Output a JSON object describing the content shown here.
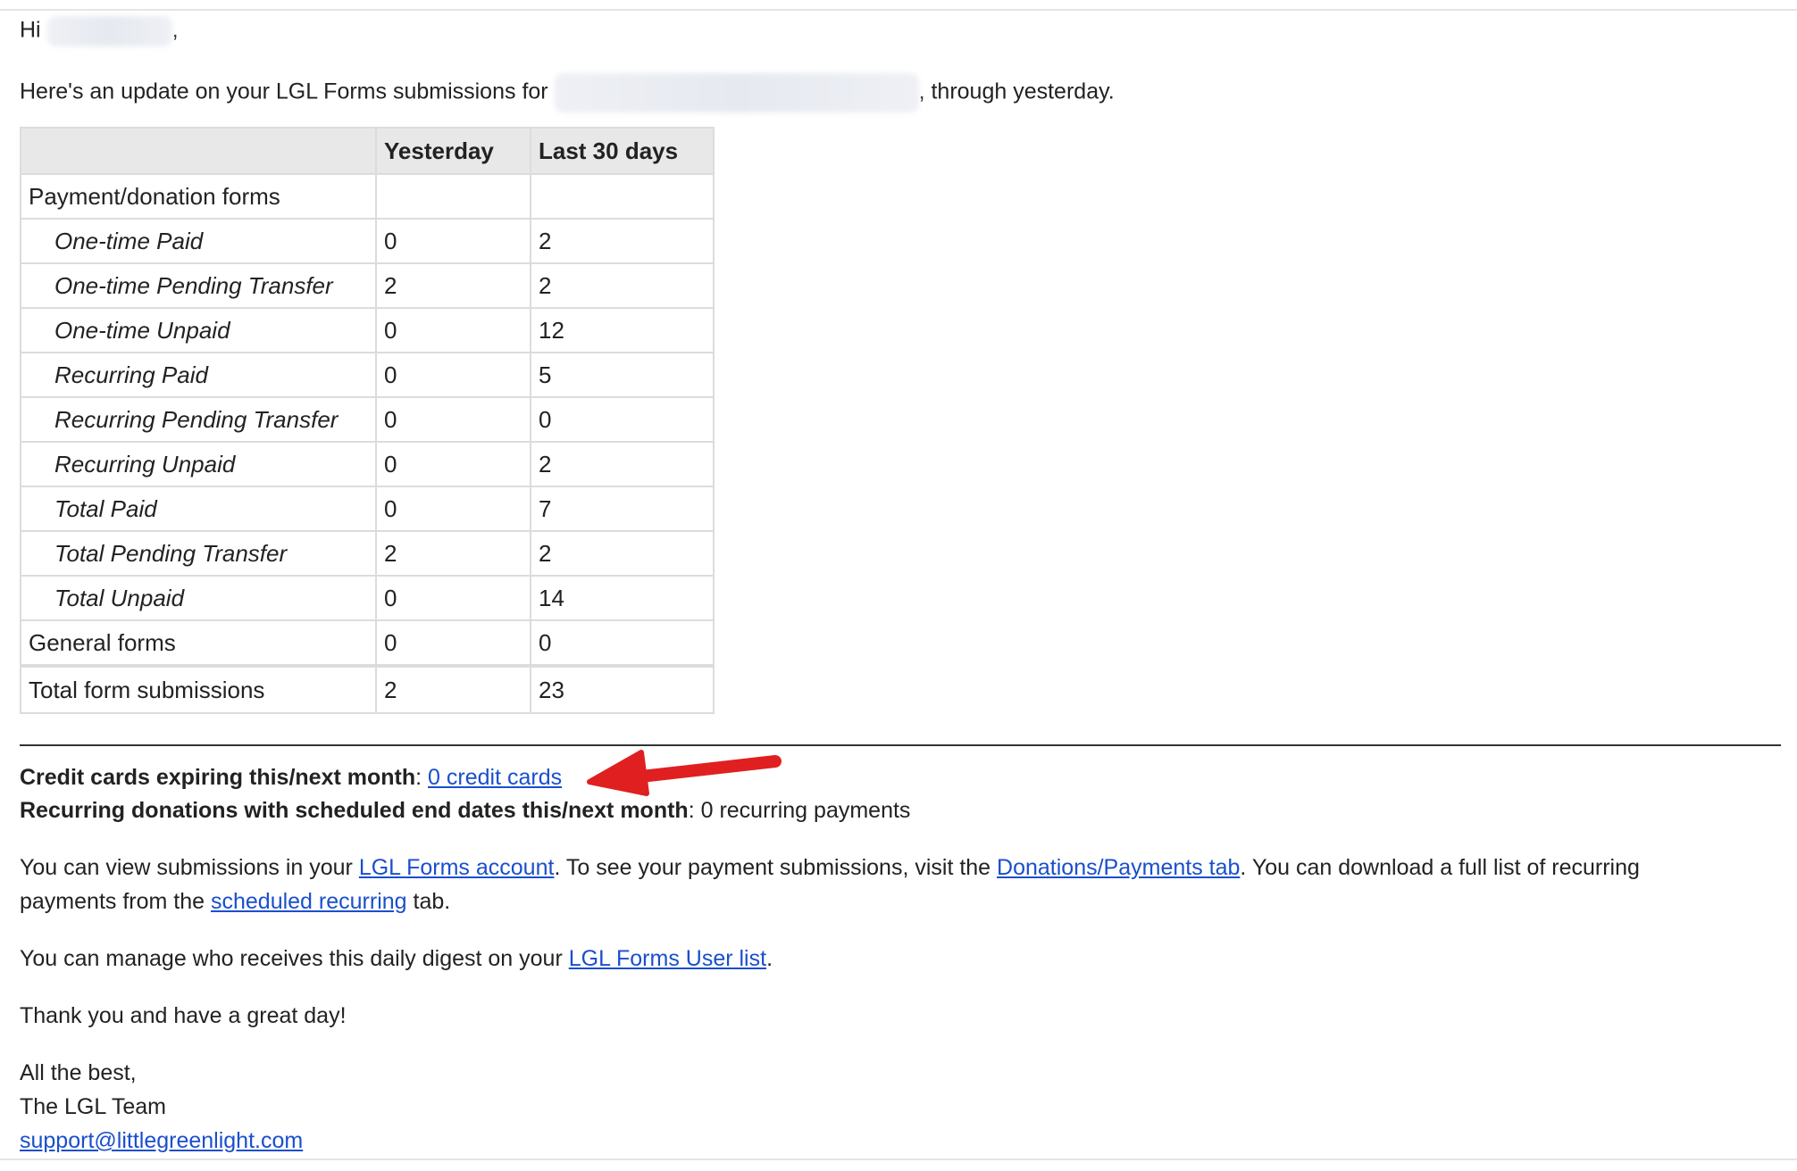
{
  "greeting": {
    "hi": "Hi",
    "comma": ","
  },
  "intro": {
    "before": "Here's an update on your LGL Forms submissions for",
    "after": ", through yesterday."
  },
  "table": {
    "headers": [
      "",
      "Yesterday",
      "Last 30 days"
    ],
    "rows": [
      {
        "label": "Payment/donation forms",
        "yesterday": "",
        "last30": ""
      },
      {
        "label": "One-time Paid",
        "yesterday": "0",
        "last30": "2"
      },
      {
        "label": "One-time Pending Transfer",
        "yesterday": "2",
        "last30": "2"
      },
      {
        "label": "One-time Unpaid",
        "yesterday": "0",
        "last30": "12"
      },
      {
        "label": "Recurring Paid",
        "yesterday": "0",
        "last30": "5"
      },
      {
        "label": "Recurring Pending Transfer",
        "yesterday": "0",
        "last30": "0"
      },
      {
        "label": "Recurring Unpaid",
        "yesterday": "0",
        "last30": "2"
      },
      {
        "label": "Total Paid",
        "yesterday": "0",
        "last30": "7"
      },
      {
        "label": "Total Pending Transfer",
        "yesterday": "2",
        "last30": "2"
      },
      {
        "label": "Total Unpaid",
        "yesterday": "0",
        "last30": "14"
      },
      {
        "label": "General forms",
        "yesterday": "0",
        "last30": "0"
      },
      {
        "label": "Total form submissions",
        "yesterday": "2",
        "last30": "23"
      }
    ]
  },
  "credit": {
    "label": "Credit cards expiring this/next month",
    "colon": ":",
    "link": "0 credit cards"
  },
  "recurring": {
    "label": "Recurring donations with scheduled end dates this/next month",
    "colon": ":",
    "value": "0 recurring payments"
  },
  "view": {
    "t1": "You can view submissions in your ",
    "link1": "LGL Forms account",
    "t2": ". To see your payment submissions, visit the ",
    "link2": "Donations/Payments tab",
    "t3": ". You can download a full list of recurring",
    "t4": "payments from the ",
    "link3": "scheduled recurring",
    "t5": " tab."
  },
  "manage": {
    "t1": "You can manage who receives this daily digest on your ",
    "link": "LGL Forms User list",
    "t2": "."
  },
  "thanks": "Thank you and have a great day!",
  "signoff": {
    "line1": "All the best,",
    "line2": "The LGL Team",
    "email": "support@littlegreenlight.com"
  },
  "colors": {
    "link": "#1a4fcc",
    "arrow": "#e02020",
    "header_bg": "#e8e8e8"
  }
}
